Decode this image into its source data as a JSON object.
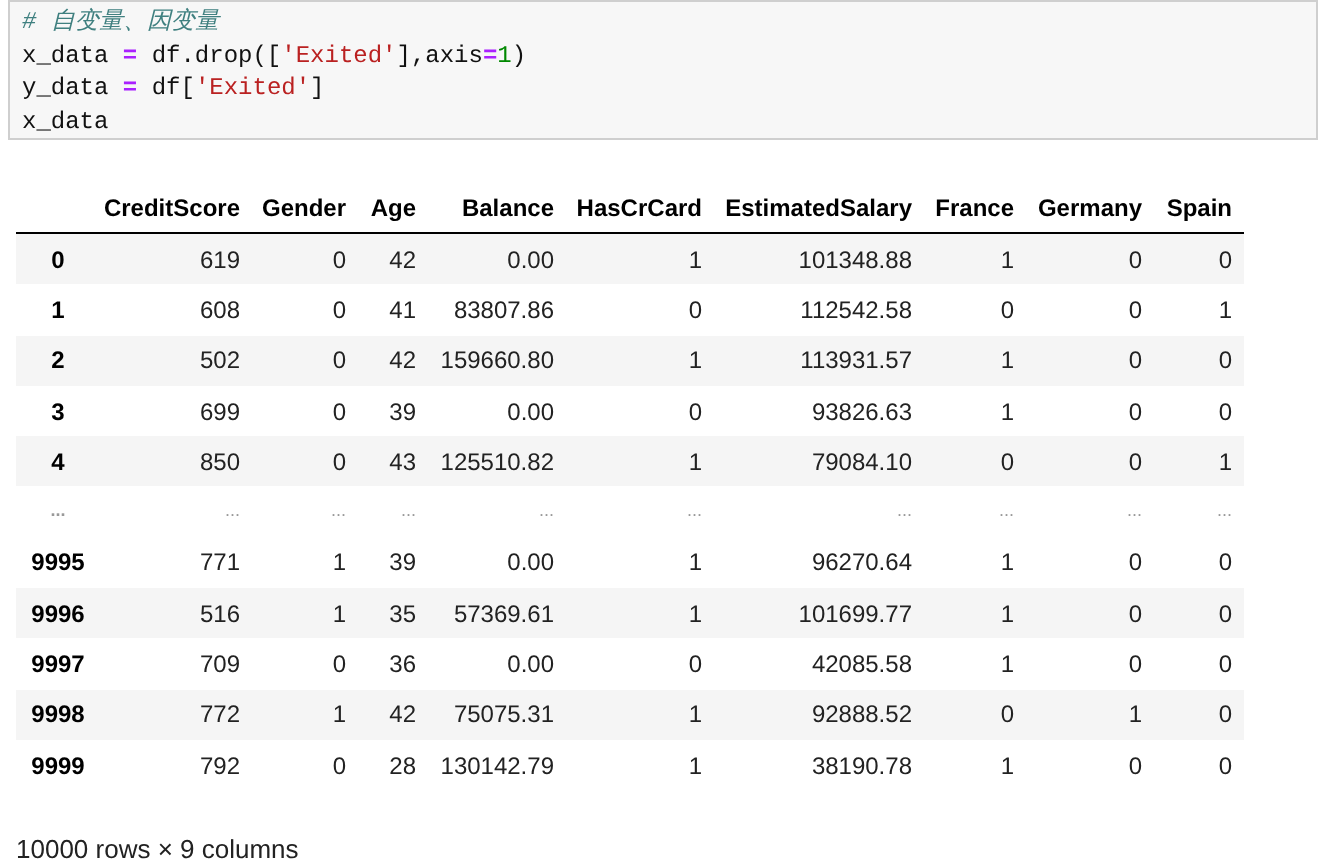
{
  "code_cell": {
    "lines": [
      [
        {
          "text": "# 自变量、因变量",
          "kind": "comment"
        }
      ],
      [
        {
          "text": "x_data ",
          "kind": "name"
        },
        {
          "text": "=",
          "kind": "op"
        },
        {
          "text": " df.drop([",
          "kind": "name"
        },
        {
          "text": "'Exited'",
          "kind": "string"
        },
        {
          "text": "],axis",
          "kind": "name"
        },
        {
          "text": "=",
          "kind": "op"
        },
        {
          "text": "1",
          "kind": "number"
        },
        {
          "text": ")",
          "kind": "name"
        }
      ],
      [
        {
          "text": "y_data ",
          "kind": "name"
        },
        {
          "text": "=",
          "kind": "op"
        },
        {
          "text": " df[",
          "kind": "name"
        },
        {
          "text": "'Exited'",
          "kind": "string"
        },
        {
          "text": "]",
          "kind": "name"
        }
      ],
      [
        {
          "text": "x_data",
          "kind": "name"
        }
      ]
    ]
  },
  "table": {
    "columns": [
      "CreditScore",
      "Gender",
      "Age",
      "Balance",
      "HasCrCard",
      "EstimatedSalary",
      "France",
      "Germany",
      "Spain"
    ],
    "rows": [
      {
        "kind": "data",
        "index": "0",
        "cells": [
          "619",
          "0",
          "42",
          "0.00",
          "1",
          "101348.88",
          "1",
          "0",
          "0"
        ]
      },
      {
        "kind": "data",
        "index": "1",
        "cells": [
          "608",
          "0",
          "41",
          "83807.86",
          "0",
          "112542.58",
          "0",
          "0",
          "1"
        ]
      },
      {
        "kind": "data",
        "index": "2",
        "cells": [
          "502",
          "0",
          "42",
          "159660.80",
          "1",
          "113931.57",
          "1",
          "0",
          "0"
        ]
      },
      {
        "kind": "data",
        "index": "3",
        "cells": [
          "699",
          "0",
          "39",
          "0.00",
          "0",
          "93826.63",
          "1",
          "0",
          "0"
        ]
      },
      {
        "kind": "data",
        "index": "4",
        "cells": [
          "850",
          "0",
          "43",
          "125510.82",
          "1",
          "79084.10",
          "0",
          "0",
          "1"
        ]
      },
      {
        "kind": "ellipsis",
        "index": "...",
        "cells": [
          "...",
          "...",
          "...",
          "...",
          "...",
          "...",
          "...",
          "...",
          "..."
        ]
      },
      {
        "kind": "data",
        "index": "9995",
        "cells": [
          "771",
          "1",
          "39",
          "0.00",
          "1",
          "96270.64",
          "1",
          "0",
          "0"
        ]
      },
      {
        "kind": "data",
        "index": "9996",
        "cells": [
          "516",
          "1",
          "35",
          "57369.61",
          "1",
          "101699.77",
          "1",
          "0",
          "0"
        ]
      },
      {
        "kind": "data",
        "index": "9997",
        "cells": [
          "709",
          "0",
          "36",
          "0.00",
          "0",
          "42085.58",
          "1",
          "0",
          "0"
        ]
      },
      {
        "kind": "data",
        "index": "9998",
        "cells": [
          "772",
          "1",
          "42",
          "75075.31",
          "1",
          "92888.52",
          "0",
          "1",
          "0"
        ]
      },
      {
        "kind": "data",
        "index": "9999",
        "cells": [
          "792",
          "0",
          "28",
          "130142.79",
          "1",
          "38190.78",
          "1",
          "0",
          "0"
        ]
      }
    ]
  },
  "footer": "10000 rows × 9 columns"
}
